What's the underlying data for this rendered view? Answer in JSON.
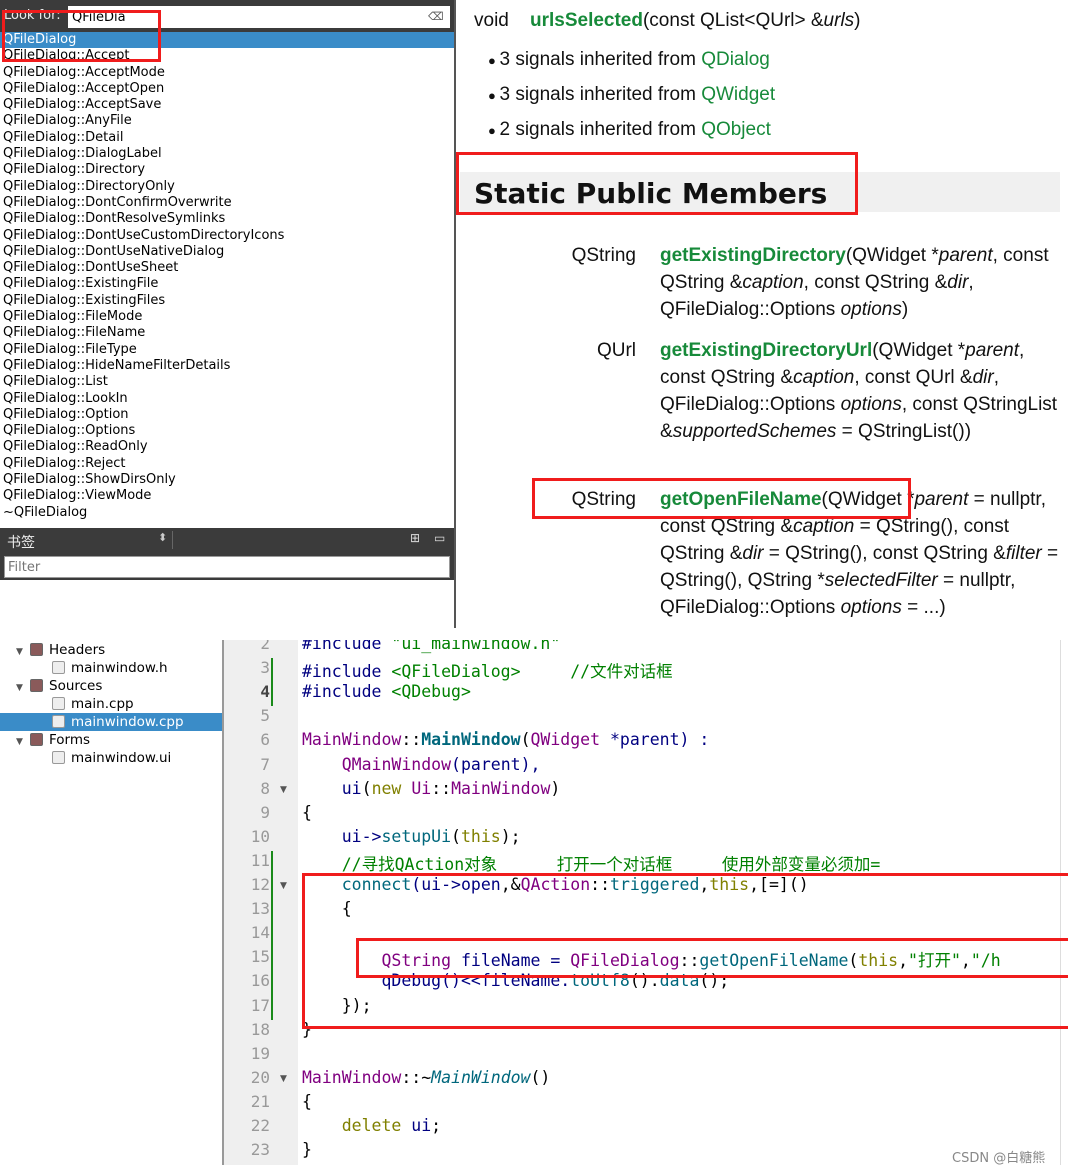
{
  "index": {
    "look_for_label": "Look for:",
    "search_value": "QFileDia",
    "items": [
      "QFileDialog",
      "QFileDialog::Accept",
      "QFileDialog::AcceptMode",
      "QFileDialog::AcceptOpen",
      "QFileDialog::AcceptSave",
      "QFileDialog::AnyFile",
      "QFileDialog::Detail",
      "QFileDialog::DialogLabel",
      "QFileDialog::Directory",
      "QFileDialog::DirectoryOnly",
      "QFileDialog::DontConfirmOverwrite",
      "QFileDialog::DontResolveSymlinks",
      "QFileDialog::DontUseCustomDirectoryIcons",
      "QFileDialog::DontUseNativeDialog",
      "QFileDialog::DontUseSheet",
      "QFileDialog::ExistingFile",
      "QFileDialog::ExistingFiles",
      "QFileDialog::FileMode",
      "QFileDialog::FileName",
      "QFileDialog::FileType",
      "QFileDialog::HideNameFilterDetails",
      "QFileDialog::List",
      "QFileDialog::LookIn",
      "QFileDialog::Option",
      "QFileDialog::Options",
      "QFileDialog::ReadOnly",
      "QFileDialog::Reject",
      "QFileDialog::ShowDirsOnly",
      "QFileDialog::ViewMode",
      "~QFileDialog"
    ],
    "selected_index": 0
  },
  "bookmarks": {
    "label": "书签",
    "filter_placeholder": "Filter"
  },
  "doc": {
    "signal": {
      "ret": "void",
      "name": "urlsSelected",
      "args": "(const QList<QUrl> &",
      "param": "urls",
      ")": ")"
    },
    "inherited": [
      {
        "pre": "3 signals inherited from ",
        "link": "QDialog"
      },
      {
        "pre": "3 signals inherited from ",
        "link": "QWidget"
      },
      {
        "pre": "2 signals inherited from ",
        "link": "QObject"
      }
    ],
    "section_title": "Static Public Members",
    "members": [
      {
        "type": "QString",
        "segs": [
          [
            "getExistingDirectory",
            "n"
          ],
          [
            "(QWidget *",
            ""
          ],
          [
            "parent",
            "i"
          ],
          [
            ", const QString &",
            ""
          ],
          [
            "caption",
            "i"
          ],
          [
            ", const QString &",
            ""
          ],
          [
            "dir",
            "i"
          ],
          [
            ", QFileDialog::Options ",
            ""
          ],
          [
            "options",
            "i"
          ],
          [
            ")",
            ""
          ]
        ]
      },
      {
        "type": "QUrl",
        "segs": [
          [
            "getExistingDirectoryUrl",
            "n"
          ],
          [
            "(QWidget *",
            ""
          ],
          [
            "parent",
            "i"
          ],
          [
            ", const QString &",
            ""
          ],
          [
            "caption",
            "i"
          ],
          [
            ", const QUrl &",
            ""
          ],
          [
            "dir",
            "i"
          ],
          [
            ", QFileDialog::Options ",
            ""
          ],
          [
            "options",
            "i"
          ],
          [
            ", const QStringList &",
            ""
          ],
          [
            "supportedSchemes",
            "i"
          ],
          [
            " = QStringList())",
            ""
          ]
        ]
      },
      {
        "type": "QString",
        "segs": [
          [
            "getOpenFileName",
            "n"
          ],
          [
            "(QWidget *",
            ""
          ],
          [
            "parent",
            "i"
          ],
          [
            " = nullptr, const QString &",
            ""
          ],
          [
            "caption",
            "i"
          ],
          [
            " = QString(), const QString &",
            ""
          ],
          [
            "dir",
            "i"
          ],
          [
            " = QString(), const QString &",
            ""
          ],
          [
            "filter",
            "i"
          ],
          [
            " = QString(), QString *",
            ""
          ],
          [
            "selectedFilter",
            "i"
          ],
          [
            " = nullptr, QFileDialog::Options ",
            ""
          ],
          [
            "options",
            "i"
          ],
          [
            " = ...)",
            ""
          ]
        ]
      }
    ]
  },
  "project_tree": [
    {
      "label": "Headers",
      "kind": "folder",
      "icon": "headers-folder-icon",
      "depth": 0
    },
    {
      "label": "mainwindow.h",
      "kind": "file",
      "icon": "header-file-icon",
      "depth": 1
    },
    {
      "label": "Sources",
      "kind": "folder",
      "icon": "sources-folder-icon",
      "depth": 0
    },
    {
      "label": "main.cpp",
      "kind": "file",
      "icon": "cpp-file-icon",
      "depth": 1
    },
    {
      "label": "mainwindow.cpp",
      "kind": "file",
      "icon": "cpp-file-icon",
      "depth": 1,
      "selected": true
    },
    {
      "label": "Forms",
      "kind": "folder",
      "icon": "forms-folder-icon",
      "depth": 0
    },
    {
      "label": "mainwindow.ui",
      "kind": "file",
      "icon": "ui-file-icon",
      "depth": 1
    }
  ],
  "code": {
    "first_line": 2,
    "current_line": 4,
    "lines": [
      [
        [
          "#include ",
          "p"
        ],
        [
          "\"ui_mainwindow.h\"",
          "g"
        ]
      ],
      [
        [
          "#include ",
          "p"
        ],
        [
          "<QFileDialog>",
          "g"
        ],
        [
          "     //文件对话框",
          "g"
        ]
      ],
      [
        [
          "#include ",
          "p"
        ],
        [
          "<QDebug>",
          "g"
        ]
      ],
      [],
      [
        [
          "MainWindow",
          "k"
        ],
        [
          "::",
          "x"
        ],
        [
          "MainWindow",
          "b"
        ],
        [
          "(",
          "x"
        ],
        [
          "QWidget",
          "k"
        ],
        [
          " *parent) :",
          "p"
        ]
      ],
      [
        [
          "    ",
          ""
        ],
        [
          "QMainWindow",
          "k"
        ],
        [
          "(parent),",
          "p"
        ]
      ],
      [
        [
          "    ",
          ""
        ],
        [
          "ui",
          "p"
        ],
        [
          "(",
          "x"
        ],
        [
          "new ",
          "o"
        ],
        [
          "Ui",
          "k"
        ],
        [
          "::",
          "x"
        ],
        [
          "MainWindow",
          "k"
        ],
        [
          ")",
          "x"
        ]
      ],
      [
        [
          "{",
          "x"
        ]
      ],
      [
        [
          "    ",
          ""
        ],
        [
          "ui->",
          "p"
        ],
        [
          "setupUi",
          "f"
        ],
        [
          "(",
          "x"
        ],
        [
          "this",
          "o"
        ],
        [
          ");",
          "x"
        ]
      ],
      [
        [
          "    ",
          ""
        ],
        [
          "//寻找QAction对象      打开一个对话框     使用外部变量必须加=",
          "g"
        ]
      ],
      [
        [
          "    ",
          ""
        ],
        [
          "connect",
          "f"
        ],
        [
          "(ui->",
          "p"
        ],
        [
          "open",
          "p"
        ],
        [
          ",&",
          "x"
        ],
        [
          "QAction",
          "k"
        ],
        [
          "::",
          "x"
        ],
        [
          "triggered",
          "f"
        ],
        [
          ",",
          "x"
        ],
        [
          "this",
          "o"
        ],
        [
          ",[=]()",
          "x"
        ]
      ],
      [
        [
          "    ",
          ""
        ],
        [
          "{",
          "x"
        ]
      ],
      [],
      [
        [
          "        ",
          ""
        ],
        [
          "QString",
          "k"
        ],
        [
          " fileName = ",
          "p"
        ],
        [
          "QFileDialog",
          "k"
        ],
        [
          "::",
          "x"
        ],
        [
          "getOpenFileName",
          "f"
        ],
        [
          "(",
          "x"
        ],
        [
          "this",
          "o"
        ],
        [
          ",",
          "x"
        ],
        [
          "\"打开\"",
          "g"
        ],
        [
          ",",
          "x"
        ],
        [
          "\"/h",
          "g"
        ]
      ],
      [
        [
          "        ",
          ""
        ],
        [
          "qDebug",
          "p"
        ],
        [
          "()<<fileName.",
          "p"
        ],
        [
          "toUtf8",
          "f"
        ],
        [
          "().",
          "x"
        ],
        [
          "data",
          "f"
        ],
        [
          "();",
          "x"
        ]
      ],
      [
        [
          "    ",
          ""
        ],
        [
          "});",
          "x"
        ]
      ],
      [
        [
          "}",
          "x"
        ]
      ],
      [],
      [
        [
          "MainWindow",
          "k"
        ],
        [
          "::~",
          "x"
        ],
        [
          "MainWindow",
          "i"
        ],
        [
          "()",
          "x"
        ]
      ],
      [
        [
          "{",
          "x"
        ]
      ],
      [
        [
          "    ",
          ""
        ],
        [
          "delete ",
          "o"
        ],
        [
          "ui",
          "p"
        ],
        [
          ";",
          "x"
        ]
      ],
      [
        [
          "}",
          "x"
        ]
      ]
    ]
  },
  "watermark": "CSDN @白糖熊",
  "colors": {
    "highlight": "#f01c1c",
    "selection": "#3a8cc8",
    "doc_link": "#178a3a"
  }
}
